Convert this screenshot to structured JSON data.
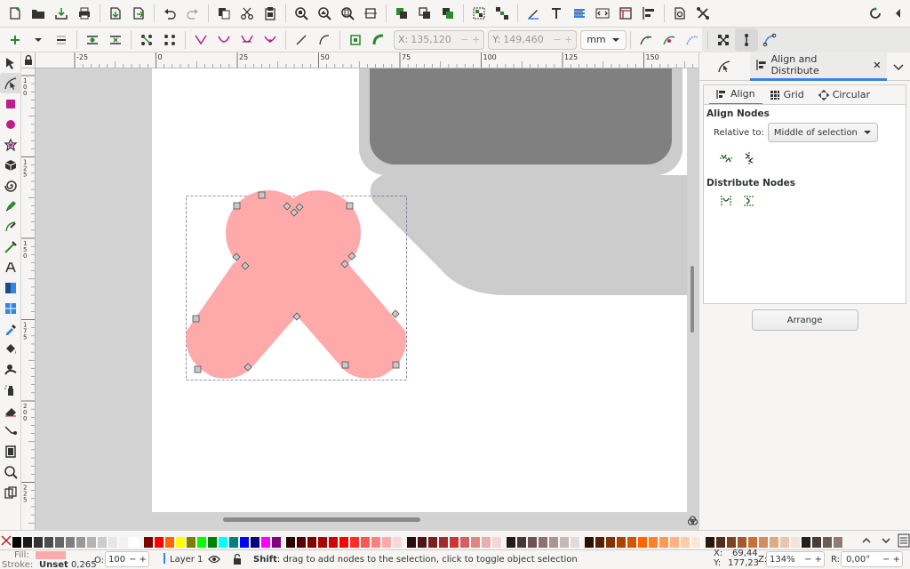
{
  "command_bar": {
    "icons": [
      "new-document-icon",
      "open-document-icon",
      "save-icon",
      "print-icon",
      "import-icon",
      "export-icon",
      "undo-icon",
      "redo-icon",
      "copy-icon",
      "cut-icon",
      "paste-icon",
      "zoom-selection-icon",
      "zoom-drawing-icon",
      "zoom-page-icon",
      "zoom-page-width-icon",
      "duplicate-icon",
      "clone-icon",
      "unlink-clone-icon",
      "group-icon",
      "ungroup-icon",
      "fill-stroke-icon",
      "text-font-icon",
      "layers-icon",
      "xml-editor-icon",
      "document-properties-icon",
      "align-distribute-icon",
      "find-replace-icon",
      "preferences-icon"
    ],
    "right_icons": [
      "snap-toggle-icon",
      "snap-menu-icon"
    ]
  },
  "node_toolbar": {
    "x_label": "X:",
    "x_value": "135,120",
    "y_label": "Y:",
    "y_value": "149,460",
    "unit": "mm"
  },
  "toolbox": [
    "selector-tool-icon",
    "node-tool-icon",
    "rectangle-tool-icon",
    "ellipse-tool-icon",
    "star-tool-icon",
    "3d-box-tool-icon",
    "spiral-tool-icon",
    "pencil-tool-icon",
    "pen-tool-icon",
    "calligraphy-tool-icon",
    "text-tool-icon",
    "gradient-tool-icon",
    "mesh-tool-icon",
    "dropper-tool-icon",
    "paint-bucket-tool-icon",
    "tweak-tool-icon",
    "spray-tool-icon",
    "eraser-tool-icon",
    "connector-tool-icon",
    "page-tool-icon",
    "zoom-tool-icon",
    "measure-tool-icon"
  ],
  "ruler": {
    "h_labels": [
      "-25",
      "0",
      "25",
      "50",
      "75",
      "100",
      "125",
      "150"
    ],
    "v_labels": [
      "1 0 0",
      "1 2 5",
      "1 5 0",
      "1 7 5",
      "2 0 0",
      "2 2 5"
    ]
  },
  "dock": {
    "tab_label": "Align and Distribute",
    "subtabs": [
      "Align",
      "Grid",
      "Circular"
    ],
    "align_nodes_label": "Align Nodes",
    "relative_to_label": "Relative to:",
    "relative_to_value": "Middle of selection",
    "distribute_nodes_label": "Distribute Nodes",
    "arrange_label": "Arrange"
  },
  "palette": {
    "colors": [
      "#000000",
      "#1a1a1a",
      "#333333",
      "#4d4d4d",
      "#666666",
      "#808080",
      "#999999",
      "#b3b3b3",
      "#cccccc",
      "#e6e6e6",
      "#f2f2f2",
      "#ffffff",
      "#800000",
      "#ff0000",
      "#ff6600",
      "#ffff00",
      "#808000",
      "#00ff00",
      "#008000",
      "#00ffff",
      "#008080",
      "#0000ff",
      "#000080",
      "#ff00ff",
      "#800080",
      "#2b0000",
      "#550000",
      "#800000",
      "#aa0000",
      "#d40000",
      "#ff0000",
      "#ff2a2a",
      "#ff5555",
      "#ff8080",
      "#ffaaaa",
      "#ffd5d5",
      "#280b0b",
      "#501616",
      "#782121",
      "#a02c2c",
      "#c83737",
      "#d35f5f",
      "#de8787",
      "#e9afaf",
      "#f4d7d7",
      "#241c1c",
      "#483737",
      "#6c5353",
      "#916f6f",
      "#ac9393",
      "#c8b7b7",
      "#e3dbdb",
      "#2b1100",
      "#552200",
      "#803300",
      "#aa4400",
      "#d45500",
      "#ff6600",
      "#ff7f2a",
      "#ff9955",
      "#ffb380",
      "#ffccaa",
      "#ffe6d5",
      "#28170b",
      "#502d16",
      "#784421",
      "#a05a2c",
      "#c87137",
      "#d38d5f",
      "#deaa87",
      "#e9c6af",
      "#f4e3d7",
      "#241f1c",
      "#483e37",
      "#6c5d53",
      "#917c6f"
    ]
  },
  "status": {
    "fill_label": "Fill:",
    "fill_color": "#ffaaaa",
    "stroke_label": "Stroke:",
    "stroke_value": "Unset",
    "stroke_width": "0,265",
    "opacity_label": "O:",
    "opacity_value": "100",
    "layer_label": "Layer 1",
    "message_bold": "Shift",
    "message": ": drag to add nodes to the selection, click to toggle object selection",
    "x_label": "X:",
    "x_value": "69,44",
    "y_label": "Y:",
    "y_value": "177,23",
    "zoom_label": "Z:",
    "zoom_value": "134%",
    "rotation_label": "R:",
    "rotation_value": "0,00°"
  }
}
